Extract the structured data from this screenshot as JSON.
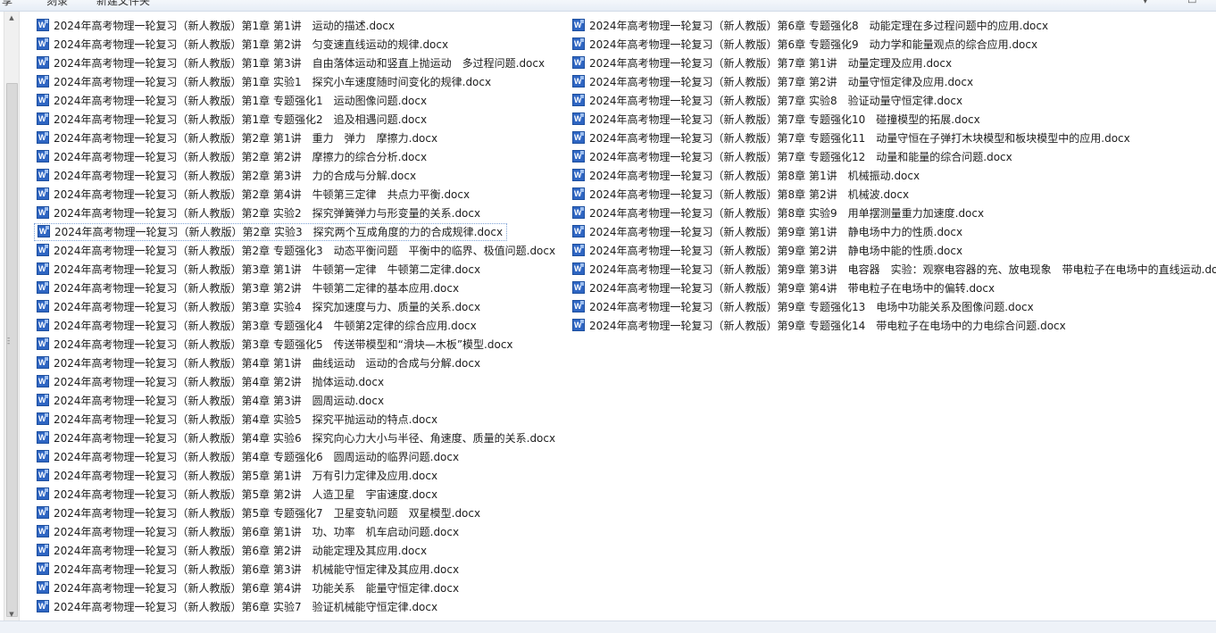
{
  "toolbar": {
    "items": [
      "享",
      "刻录",
      "新建文件夹"
    ]
  },
  "file_list": {
    "column_1": [
      "2024年高考物理一轮复习（新人教版）第1章 第1讲　运动的描述.docx",
      "2024年高考物理一轮复习（新人教版）第1章 第2讲　匀变速直线运动的规律.docx",
      "2024年高考物理一轮复习（新人教版）第1章 第3讲　自由落体运动和竖直上抛运动　多过程问题.docx",
      "2024年高考物理一轮复习（新人教版）第1章 实验1　探究小车速度随时间变化的规律.docx",
      "2024年高考物理一轮复习（新人教版）第1章 专题强化1　运动图像问题.docx",
      "2024年高考物理一轮复习（新人教版）第1章 专题强化2　追及相遇问题.docx",
      "2024年高考物理一轮复习（新人教版）第2章 第1讲　重力　弹力　摩擦力.docx",
      "2024年高考物理一轮复习（新人教版）第2章 第2讲　摩擦力的综合分析.docx",
      "2024年高考物理一轮复习（新人教版）第2章 第3讲　力的合成与分解.docx",
      "2024年高考物理一轮复习（新人教版）第2章 第4讲　牛顿第三定律　共点力平衡.docx",
      "2024年高考物理一轮复习（新人教版）第2章 实验2　探究弹簧弹力与形变量的关系.docx",
      "2024年高考物理一轮复习（新人教版）第2章 实验3　探究两个互成角度的力的合成规律.docx",
      "2024年高考物理一轮复习（新人教版）第2章 专题强化3　动态平衡问题　平衡中的临界、极值问题.docx",
      "2024年高考物理一轮复习（新人教版）第3章 第1讲　牛顿第一定律　牛顿第二定律.docx",
      "2024年高考物理一轮复习（新人教版）第3章 第2讲　牛顿第二定律的基本应用.docx",
      "2024年高考物理一轮复习（新人教版）第3章 实验4　探究加速度与力、质量的关系.docx",
      "2024年高考物理一轮复习（新人教版）第3章 专题强化4　牛顿第2定律的综合应用.docx",
      "2024年高考物理一轮复习（新人教版）第3章 专题强化5　传送带模型和“滑块—木板”模型.docx",
      "2024年高考物理一轮复习（新人教版）第4章 第1讲　曲线运动　运动的合成与分解.docx",
      "2024年高考物理一轮复习（新人教版）第4章 第2讲　抛体运动.docx",
      "2024年高考物理一轮复习（新人教版）第4章 第3讲　圆周运动.docx",
      "2024年高考物理一轮复习（新人教版）第4章 实验5　探究平抛运动的特点.docx",
      "2024年高考物理一轮复习（新人教版）第4章 实验6　探究向心力大小与半径、角速度、质量的关系.docx",
      "2024年高考物理一轮复习（新人教版）第4章 专题强化6　圆周运动的临界问题.docx",
      "2024年高考物理一轮复习（新人教版）第5章 第1讲　万有引力定律及应用.docx",
      "2024年高考物理一轮复习（新人教版）第5章 第2讲　人造卫星　宇宙速度.docx",
      "2024年高考物理一轮复习（新人教版）第5章 专题强化7　卫星变轨问题　双星模型.docx",
      "2024年高考物理一轮复习（新人教版）第6章 第1讲　功、功率　机车启动问题.docx",
      "2024年高考物理一轮复习（新人教版）第6章 第2讲　动能定理及其应用.docx",
      "2024年高考物理一轮复习（新人教版）第6章 第3讲　机械能守恒定律及其应用.docx",
      "2024年高考物理一轮复习（新人教版）第6章 第4讲　功能关系　能量守恒定律.docx",
      "2024年高考物理一轮复习（新人教版）第6章 实验7　验证机械能守恒定律.docx"
    ],
    "column_2": [
      "2024年高考物理一轮复习（新人教版）第6章 专题强化8　动能定理在多过程问题中的应用.docx",
      "2024年高考物理一轮复习（新人教版）第6章 专题强化9　动力学和能量观点的综合应用.docx",
      "2024年高考物理一轮复习（新人教版）第7章 第1讲　动量定理及应用.docx",
      "2024年高考物理一轮复习（新人教版）第7章 第2讲　动量守恒定律及应用.docx",
      "2024年高考物理一轮复习（新人教版）第7章 实验8　验证动量守恒定律.docx",
      "2024年高考物理一轮复习（新人教版）第7章 专题强化10　碰撞模型的拓展.docx",
      "2024年高考物理一轮复习（新人教版）第7章 专题强化11　动量守恒在子弹打木块模型和板块模型中的应用.docx",
      "2024年高考物理一轮复习（新人教版）第7章 专题强化12　动量和能量的综合问题.docx",
      "2024年高考物理一轮复习（新人教版）第8章 第1讲　机械振动.docx",
      "2024年高考物理一轮复习（新人教版）第8章 第2讲　机械波.docx",
      "2024年高考物理一轮复习（新人教版）第8章 实验9　用单摆测量重力加速度.docx",
      "2024年高考物理一轮复习（新人教版）第9章 第1讲　静电场中力的性质.docx",
      "2024年高考物理一轮复习（新人教版）第9章 第2讲　静电场中能的性质.docx",
      "2024年高考物理一轮复习（新人教版）第9章 第3讲　电容器　实验：观察电容器的充、放电现象　带电粒子在电场中的直线运动.docx",
      "2024年高考物理一轮复习（新人教版）第9章 第4讲　带电粒子在电场中的偏转.docx",
      "2024年高考物理一轮复习（新人教版）第9章 专题强化13　电场中功能关系及图像问题.docx",
      "2024年高考物理一轮复习（新人教版）第9章 专题强化14　带电粒子在电场中的力电综合问题.docx"
    ],
    "focused_item": "2024年高考物理一轮复习（新人教版）第2章 实验3　探究两个互成角度的力的合成规律.docx",
    "icon": "word-document-icon"
  },
  "colors": {
    "focus_border": "#7ea2d6",
    "word_icon": "#2f66c3",
    "scrollbar": "#f0f0f0"
  }
}
